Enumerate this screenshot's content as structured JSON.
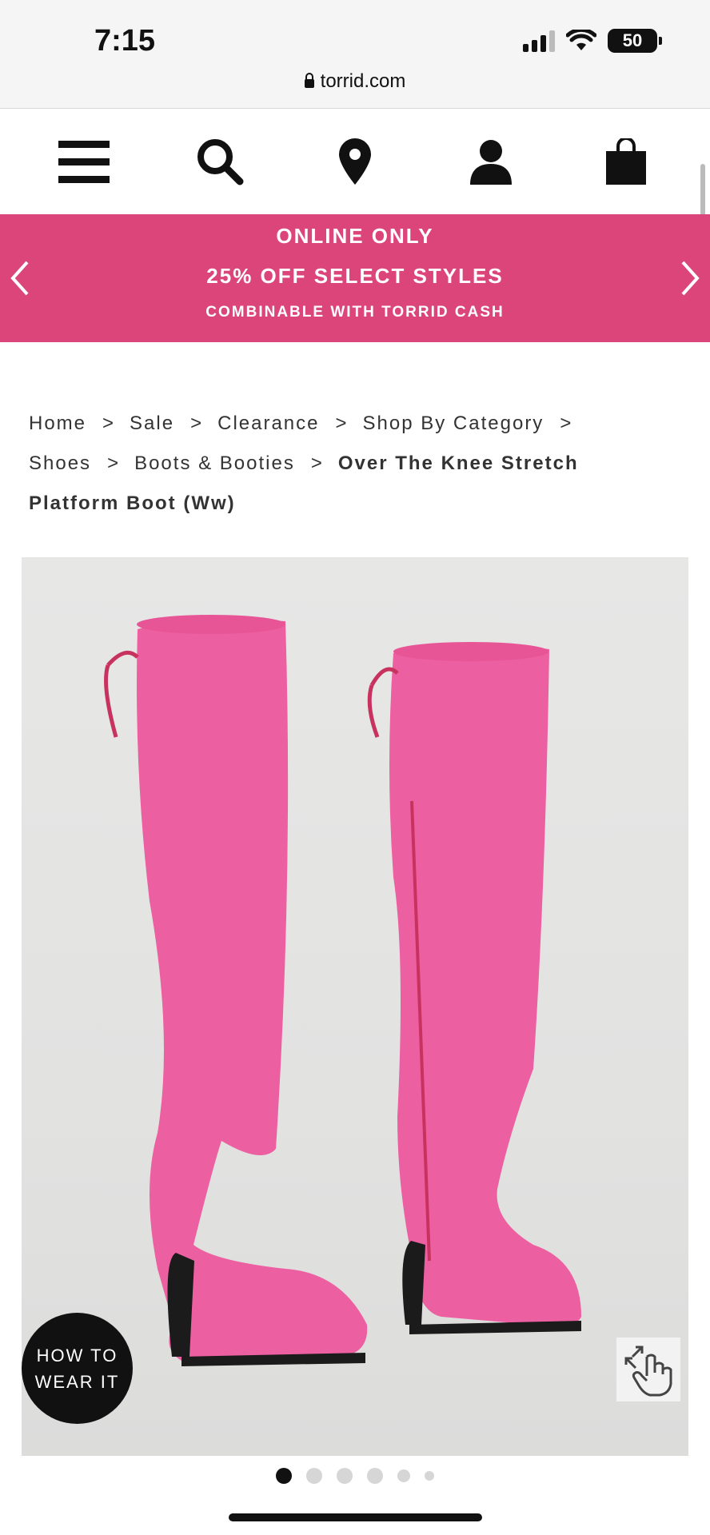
{
  "status_bar": {
    "time": "7:15",
    "battery": "50",
    "url": "torrid.com"
  },
  "nav": {
    "icons": [
      "menu-icon",
      "search-icon",
      "location-pin-icon",
      "account-icon",
      "shopping-bag-icon"
    ]
  },
  "promo": {
    "line1": "ONLINE ONLY",
    "line2": "25% OFF SELECT STYLES",
    "line3": "COMBINABLE WITH TORRID CASH",
    "background_color": "#dc4579"
  },
  "breadcrumb": {
    "items": [
      "Home",
      "Sale",
      "Clearance",
      "Shop By Category",
      "Shoes",
      "Boots & Booties"
    ],
    "current": "Over The Knee Stretch Platform Boot (Ww)",
    "separator": ">"
  },
  "product": {
    "image_alt": "Pink over the knee stretch platform boots",
    "boot_color": "#ec5fa0",
    "how_to_wear_line1": "HOW TO",
    "how_to_wear_line2": "WEAR IT"
  },
  "carousel": {
    "total": 6,
    "active": 1
  }
}
